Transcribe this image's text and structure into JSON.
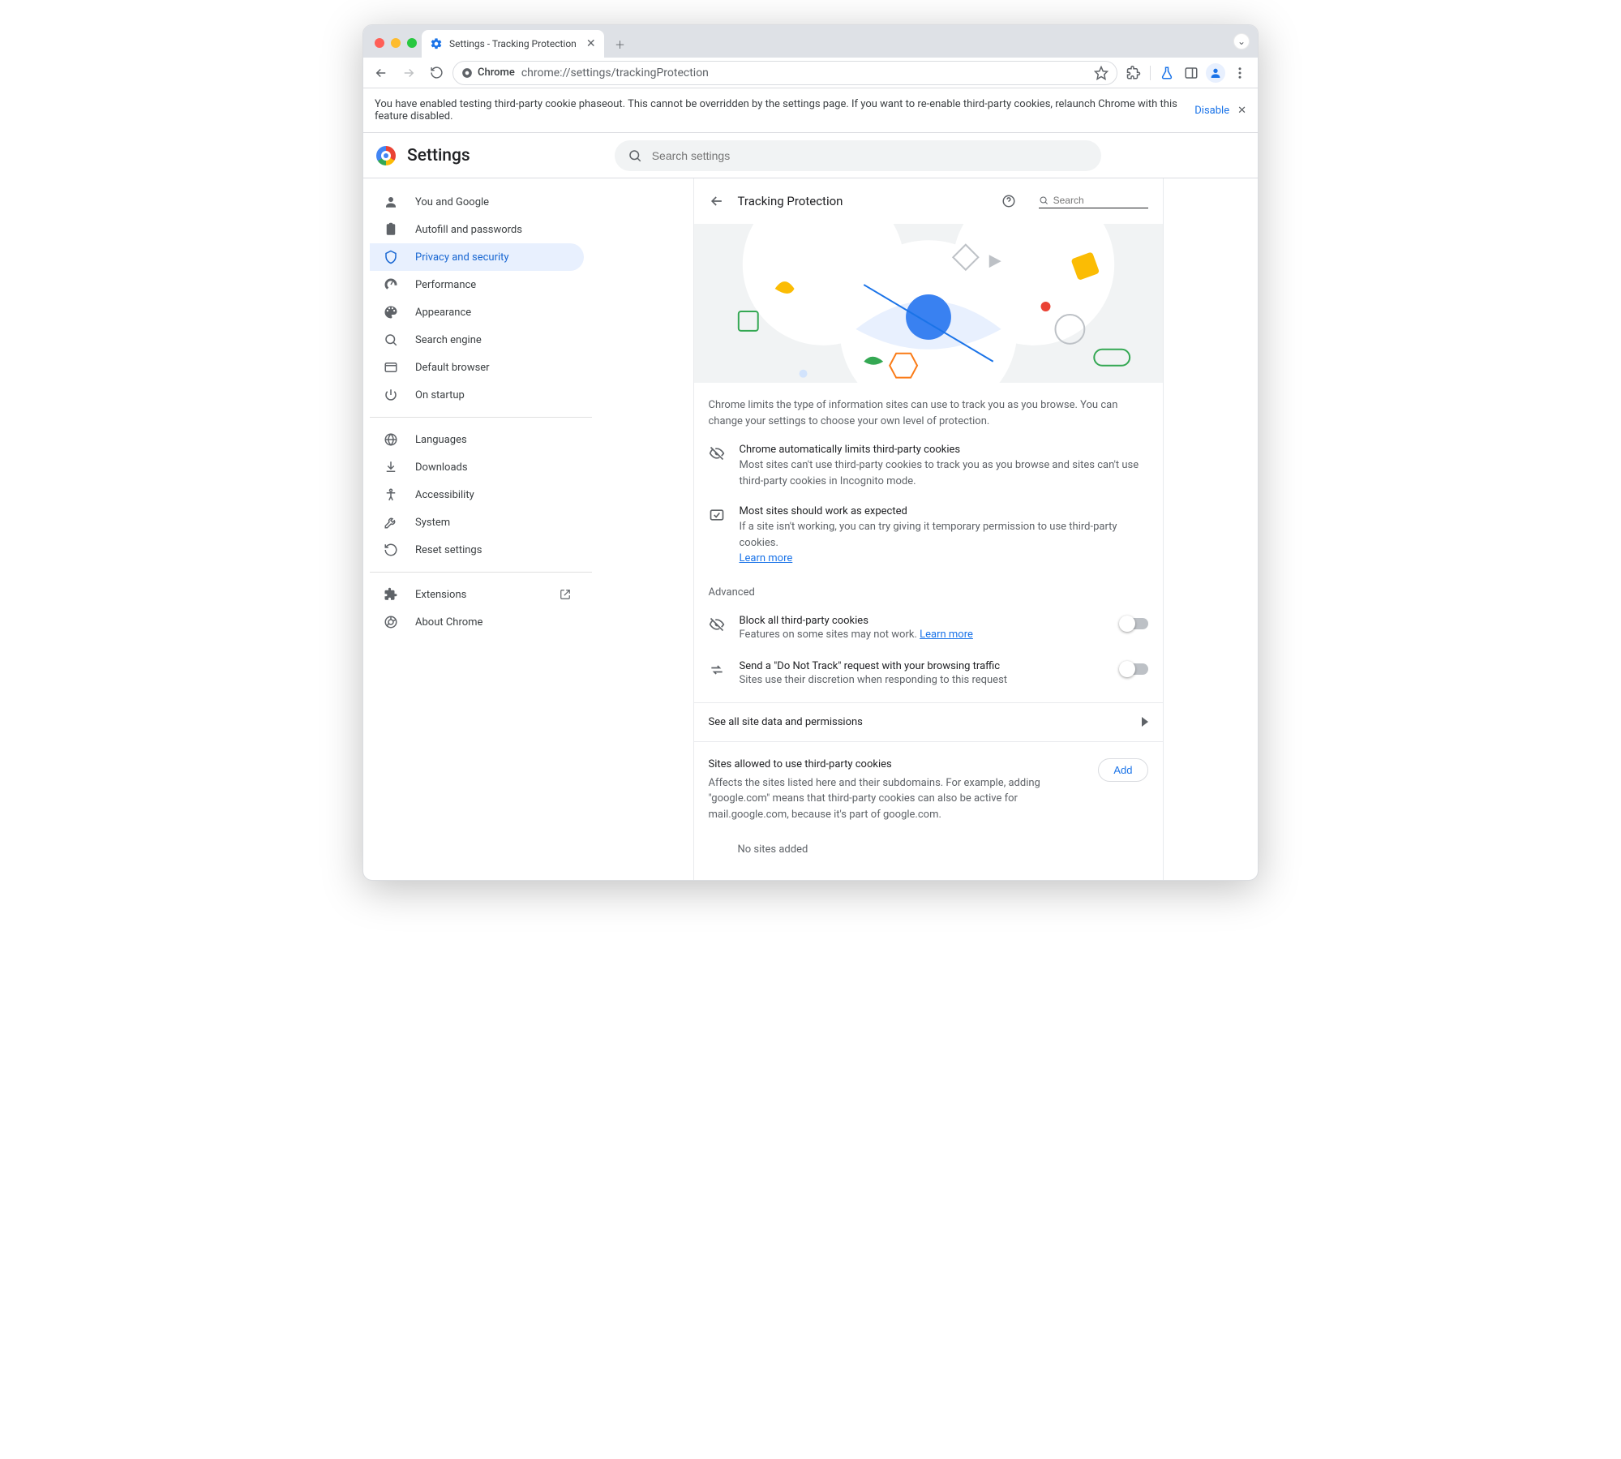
{
  "window": {
    "tab_title": "Settings - Tracking Protection"
  },
  "toolbar": {
    "chrome_chip": "Chrome",
    "url": "chrome://settings/trackingProtection"
  },
  "infobar": {
    "message": "You have enabled testing third-party cookie phaseout. This cannot be overridden by the settings page. If you want to re-enable third-party cookies, relaunch Chrome with this feature disabled.",
    "disable": "Disable"
  },
  "header": {
    "brand": "Settings",
    "search_placeholder": "Search settings"
  },
  "sidebar": {
    "items": [
      {
        "label": "You and Google"
      },
      {
        "label": "Autofill and passwords"
      },
      {
        "label": "Privacy and security"
      },
      {
        "label": "Performance"
      },
      {
        "label": "Appearance"
      },
      {
        "label": "Search engine"
      },
      {
        "label": "Default browser"
      },
      {
        "label": "On startup"
      }
    ],
    "items2": [
      {
        "label": "Languages"
      },
      {
        "label": "Downloads"
      },
      {
        "label": "Accessibility"
      },
      {
        "label": "System"
      },
      {
        "label": "Reset settings"
      }
    ],
    "items3": [
      {
        "label": "Extensions"
      },
      {
        "label": "About Chrome"
      }
    ]
  },
  "panel": {
    "title": "Tracking Protection",
    "search_placeholder": "Search",
    "description": "Chrome limits the type of information sites can use to track you as you browse. You can change your settings to choose your own level of protection.",
    "feature1": {
      "title": "Chrome automatically limits third-party cookies",
      "desc": "Most sites can't use third-party cookies to track you as you browse and sites can't use third-party cookies in Incognito mode."
    },
    "feature2": {
      "title": "Most sites should work as expected",
      "desc": "If a site isn't working, you can try giving it temporary permission to use third-party cookies.",
      "learn": "Learn more"
    },
    "advanced_label": "Advanced",
    "row1": {
      "title": "Block all third-party cookies",
      "desc": "Features on some sites may not work.",
      "learn": "Learn more"
    },
    "row2": {
      "title": "Send a \"Do Not Track\" request with your browsing traffic",
      "desc": "Sites use their discretion when responding to this request"
    },
    "see_all": "See all site data and permissions",
    "sites": {
      "title": "Sites allowed to use third-party cookies",
      "desc": "Affects the sites listed here and their subdomains. For example, adding \"google.com\" means that third-party cookies can also be active for mail.google.com, because it's part of google.com.",
      "add": "Add",
      "none": "No sites added"
    }
  }
}
